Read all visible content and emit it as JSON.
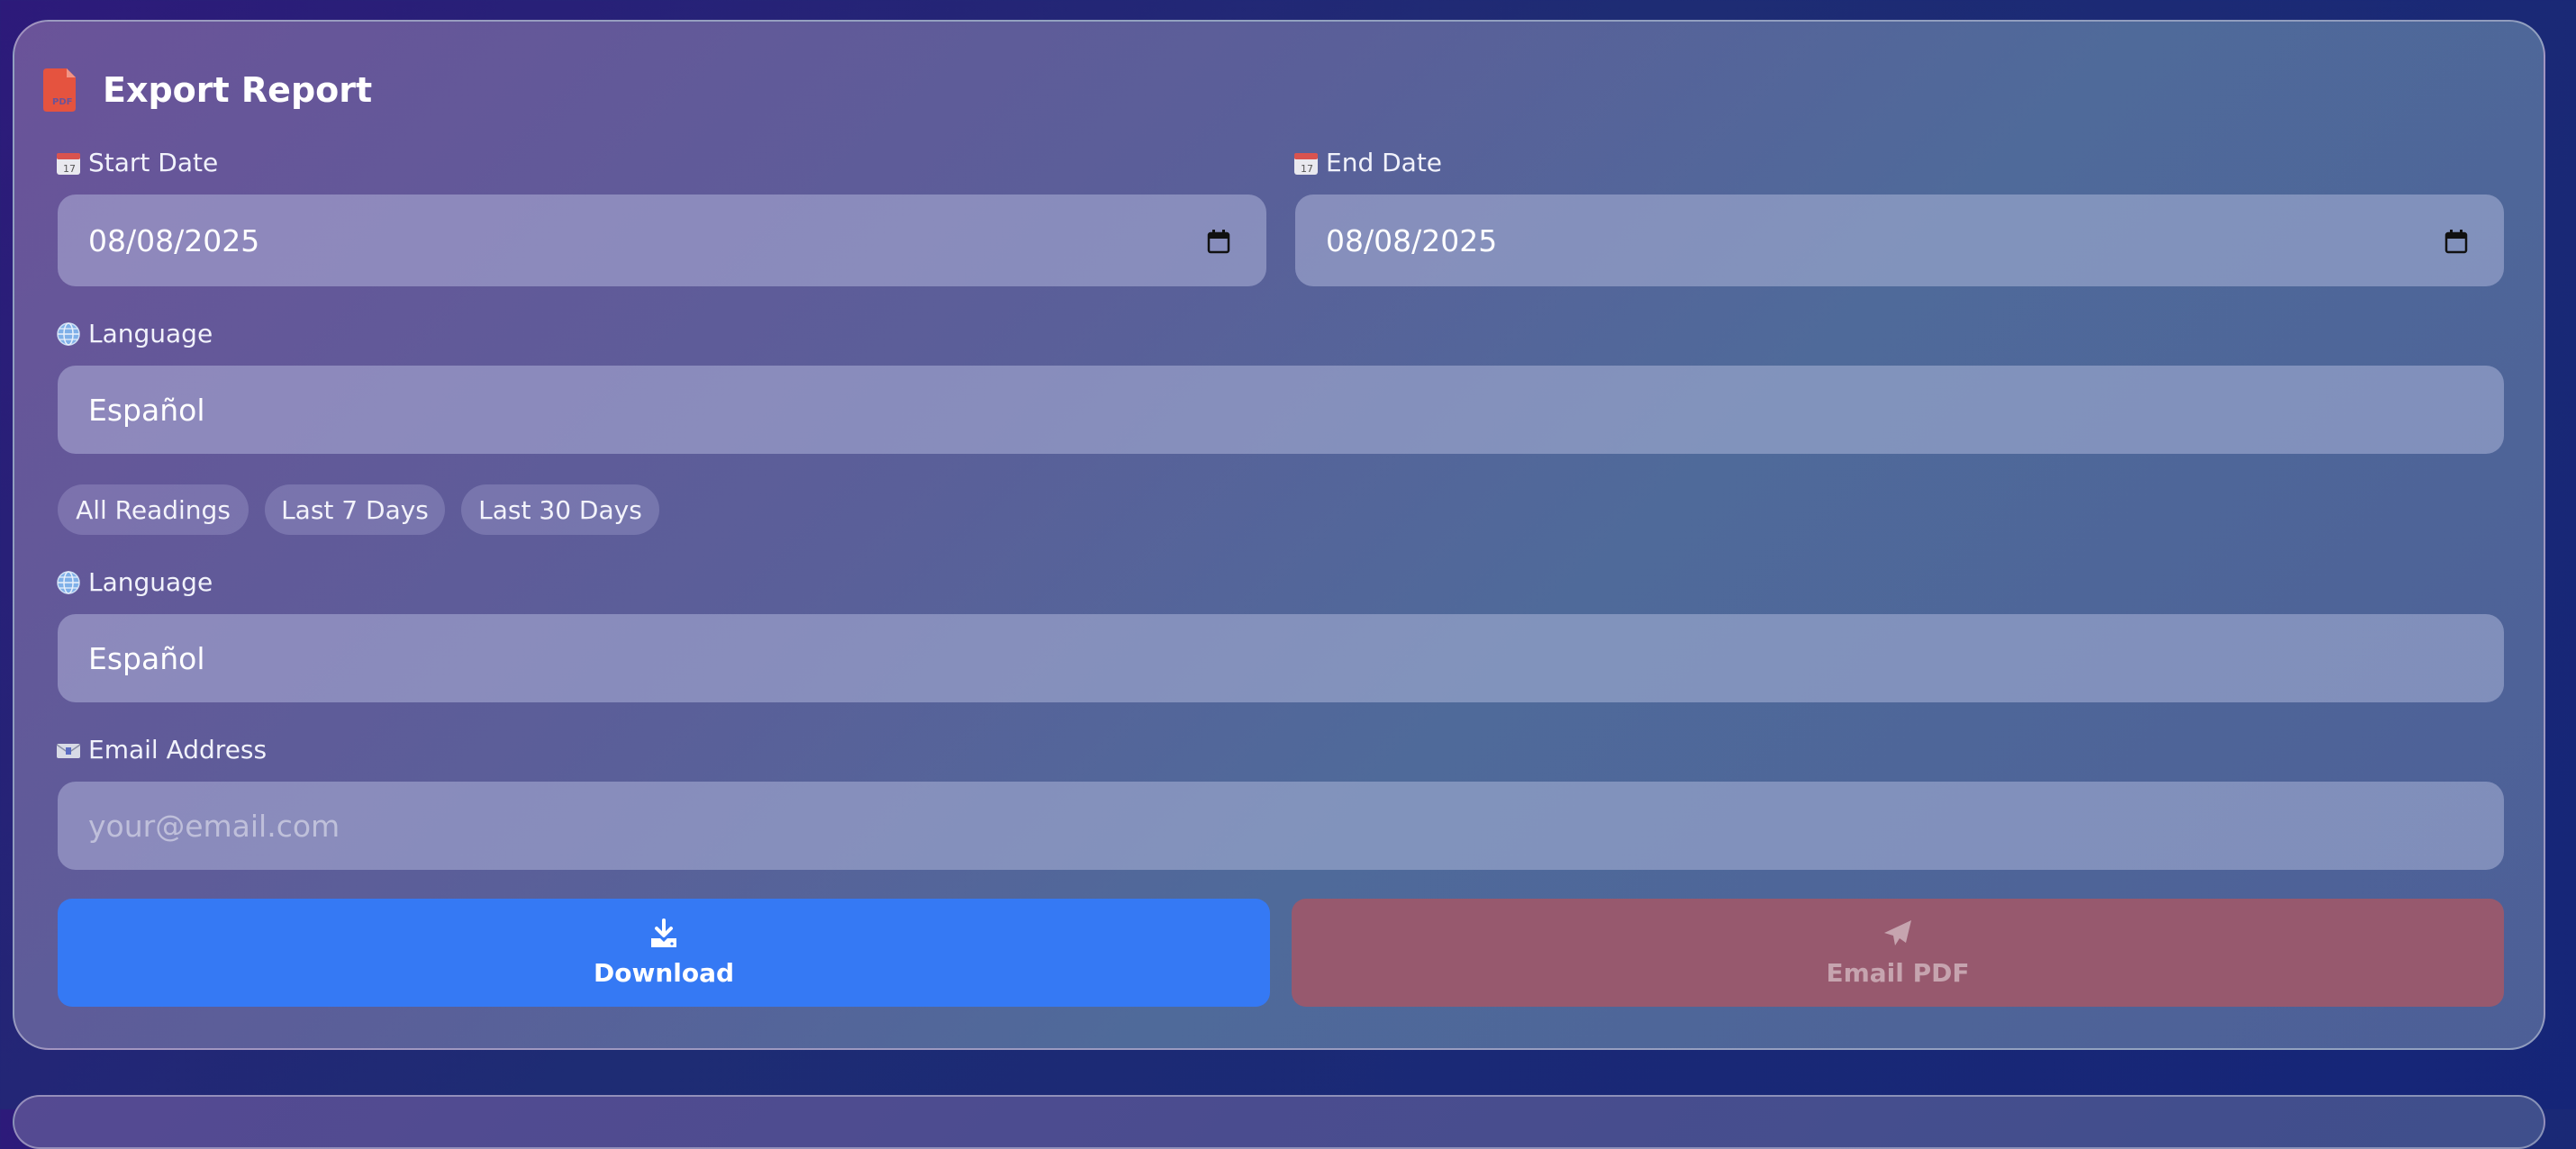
{
  "header": {
    "title": "Export Report",
    "icon": "pdf-file-icon",
    "icon_color": "#e5533f"
  },
  "date_range": {
    "start": {
      "label": "Start Date",
      "icon": "calendar-icon",
      "value": "08/08/2025"
    },
    "end": {
      "label": "End Date",
      "icon": "calendar-icon",
      "value": "08/08/2025"
    }
  },
  "language_1": {
    "label": "Language",
    "icon": "globe-icon",
    "value": "Español"
  },
  "presets": [
    {
      "label": "All Readings"
    },
    {
      "label": "Last 7 Days"
    },
    {
      "label": "Last 30 Days"
    }
  ],
  "language_2": {
    "label": "Language",
    "icon": "globe-icon",
    "value": "Español"
  },
  "email": {
    "label": "Email Address",
    "icon": "envelope-icon",
    "placeholder": "your@email.com",
    "value": ""
  },
  "actions": {
    "download_label": "Download",
    "download_color": "#3579f4",
    "email_label": "Email PDF",
    "email_color": "#97596e"
  }
}
